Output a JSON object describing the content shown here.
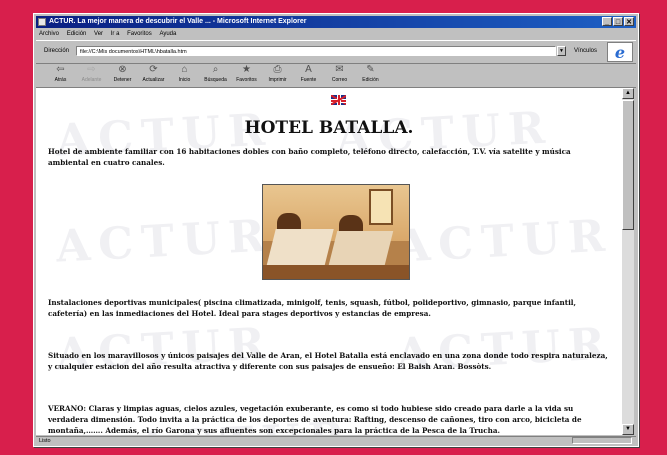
{
  "window": {
    "title": "ACTUR. La mejor manera de descubrir el Valle ... - Microsoft Internet Explorer",
    "controls": [
      "_",
      "□",
      "✕"
    ]
  },
  "menu": [
    "Archivo",
    "Edición",
    "Ver",
    "Ir a",
    "Favoritos",
    "Ayuda"
  ],
  "address": {
    "label": "Dirección",
    "value": "file://C:\\Mis documentos\\HTML\\hbatalla.htm",
    "links_label": "Vínculos"
  },
  "toolbar": [
    {
      "label": "Atrás",
      "icon": "back-icon",
      "glyph": "⇦",
      "enabled": true
    },
    {
      "label": "Adelante",
      "icon": "forward-icon",
      "glyph": "⇨",
      "enabled": false
    },
    {
      "label": "Detener",
      "icon": "stop-icon",
      "glyph": "⊗",
      "enabled": true
    },
    {
      "label": "Actualizar",
      "icon": "refresh-icon",
      "glyph": "⟳",
      "enabled": true
    },
    {
      "label": "Inicio",
      "icon": "home-icon",
      "glyph": "⌂",
      "enabled": true
    },
    {
      "label": "Búsqueda",
      "icon": "search-icon",
      "glyph": "⌕",
      "enabled": true
    },
    {
      "label": "Favoritos",
      "icon": "favorites-icon",
      "glyph": "★",
      "enabled": true
    },
    {
      "label": "Imprimir",
      "icon": "print-icon",
      "glyph": "⎙",
      "enabled": true
    },
    {
      "label": "Fuente",
      "icon": "font-icon",
      "glyph": "A",
      "enabled": true
    },
    {
      "label": "Correo",
      "icon": "mail-icon",
      "glyph": "✉",
      "enabled": true
    },
    {
      "label": "Edición",
      "icon": "edit-icon",
      "glyph": "✎",
      "enabled": true
    }
  ],
  "page": {
    "watermark": "ACTUR",
    "title": "HOTEL BATALLA.",
    "intro": "Hotel de ambiente familiar con 16 habitaciones dobles con baño completo, teléfono directo, calefacción, T.V. vía satelite y música ambiental en cuatro canales.",
    "facilities": "Instalaciones deportivas municipales( piscina climatizada, minigolf, tenis, squash, fútbol, polideportivo, gimnasio, parque infantil, cafetería) en las inmediaciones del Hotel. Ideal para stages deportivos y estancias de empresa.",
    "location": "Situado en los maravillosos y únicos paisajes del Valle de Aran, el Hotel Batalla está enclavado en una zona donde todo respira naturaleza, y cualquier estacion del año resulta atractiva y diferente con sus paisajes de ensueño: El Baish Aran. Bossòts.",
    "summer": "VERANO: Claras y limpias aguas, cielos azules, vegetación exuberante, es como si todo hubiese sido creado para darle a la vida su verdadera dimensión. Todo invita a la práctica de los deportes de aventura: Rafting, descenso de cañones, tiro con arco, bicicleta de montaña,……. Además, el río Garona y sus afluentes son excepcionales para la práctica de la Pesca de la Trucha."
  },
  "status": {
    "text": "Listo"
  },
  "colors": {
    "background": "#d81f4c",
    "titlebar": "#0a1f82",
    "chrome": "#c0c0c0"
  }
}
